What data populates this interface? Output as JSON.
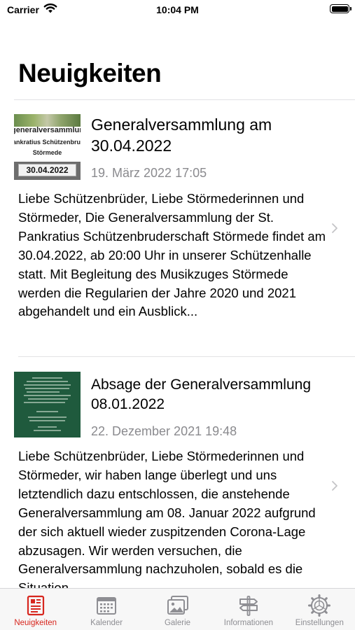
{
  "status_bar": {
    "carrier": "Carrier",
    "time": "10:04 PM"
  },
  "page": {
    "title": "Neuigkeiten"
  },
  "news": [
    {
      "thumb_lines": [
        "generalversammlung",
        "Pankratius Schützenbruder",
        "Störmede",
        "30.04.2022"
      ],
      "title": "Generalversammlung am 30.04.2022",
      "date": "19. März 2022 17:05",
      "body": "Liebe Schützenbrüder, Liebe Störmederinnen und Störmeder, Die Generalversammlung der St. Pankratius Schützenbruderschaft Störmede findet am 30.04.2022, ab 20:00 Uhr in unserer Schützenhalle statt. Mit Begleitung des Musikzuges Störmede werden die Regularien der Jahre 2020 und 2021 abgehandelt und ein Ausblick..."
    },
    {
      "title": "Absage der Generalversammlung 08.01.2022",
      "date": "22. Dezember 2021 19:48",
      "body": "Liebe Schützenbrüder, Liebe Störmederinnen und Störmeder, wir haben lange überlegt und uns letztendlich dazu entschlossen, die anstehende Generalversammlung am 08. Januar 2022 aufgrund der sich aktuell wieder zuspitzenden Corona-Lage abzusagen. Wir werden versuchen, die Generalversammlung nachzuholen, sobald es die Situation..."
    }
  ],
  "tabs": [
    {
      "label": "Neuigkeiten",
      "icon": "newspaper-icon",
      "active": true
    },
    {
      "label": "Kalender",
      "icon": "calendar-icon",
      "active": false
    },
    {
      "label": "Galerie",
      "icon": "photos-icon",
      "active": false
    },
    {
      "label": "Informationen",
      "icon": "signpost-icon",
      "active": false
    },
    {
      "label": "Einstellungen",
      "icon": "gear-icon",
      "active": false
    }
  ],
  "colors": {
    "accent": "#d7261e",
    "inactive_tab": "#8e8e93",
    "secondary_text": "#8a8a8e"
  }
}
